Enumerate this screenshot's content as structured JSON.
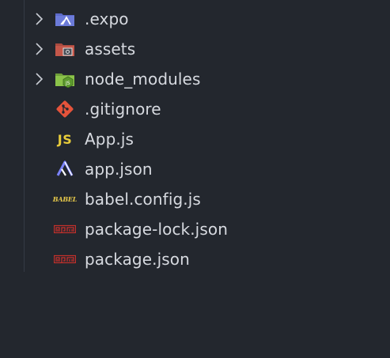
{
  "explorer": {
    "items": [
      {
        "label": ".expo",
        "type": "folder",
        "icon": "expo-folder-icon",
        "color": "#6c7bd9"
      },
      {
        "label": "assets",
        "type": "folder",
        "icon": "assets-folder-icon",
        "color": "#c4574a"
      },
      {
        "label": "node_modules",
        "type": "folder",
        "icon": "node-modules-folder-icon",
        "color": "#8bc34a"
      },
      {
        "label": ".gitignore",
        "type": "file",
        "icon": "git-icon",
        "color": "#e5533b"
      },
      {
        "label": "App.js",
        "type": "file",
        "icon": "javascript-icon",
        "badge": "JS",
        "color": "#e8cc3a"
      },
      {
        "label": "app.json",
        "type": "file",
        "icon": "expo-icon",
        "color": "#7b83ff"
      },
      {
        "label": "babel.config.js",
        "type": "file",
        "icon": "babel-icon",
        "badge": "BABEL",
        "color": "#e6c84a"
      },
      {
        "label": "package-lock.json",
        "type": "file",
        "icon": "npm-icon",
        "color": "#c4302b"
      },
      {
        "label": "package.json",
        "type": "file",
        "icon": "npm-icon",
        "color": "#c4302b"
      }
    ]
  }
}
